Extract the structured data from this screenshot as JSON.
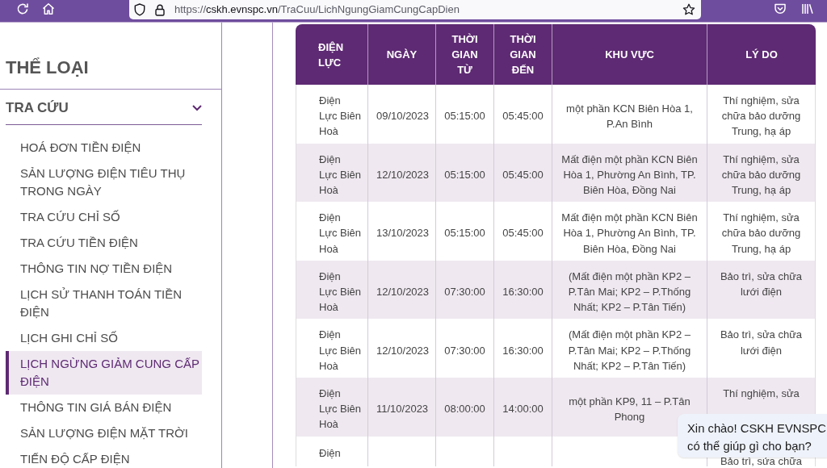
{
  "browser": {
    "url": {
      "scheme": "https://",
      "host": "cskh.evnspc.vn",
      "path": "/TraCuu/LichNgungGiamCungCapDien"
    }
  },
  "sidebar": {
    "title": "THỂ LOẠI",
    "section": {
      "label": "TRA CỨU",
      "expanded": true
    },
    "items": [
      {
        "label": "HOÁ ĐƠN TIỀN ĐIỆN",
        "selected": false
      },
      {
        "label": "SẢN LƯỢNG ĐIỆN TIÊU THỤ TRONG NGÀY",
        "selected": false
      },
      {
        "label": "TRA CỨU CHỈ SỐ",
        "selected": false
      },
      {
        "label": "TRA CỨU TIỀN ĐIỆN",
        "selected": false
      },
      {
        "label": "THÔNG TIN NỢ TIỀN ĐIỆN",
        "selected": false
      },
      {
        "label": "LỊCH SỬ THANH TOÁN TIỀN ĐIỆN",
        "selected": false
      },
      {
        "label": "LỊCH GHI CHỈ SỐ",
        "selected": false
      },
      {
        "label": "LỊCH NGỪNG GIẢM CUNG CẤP ĐIỆN",
        "selected": true
      },
      {
        "label": "THÔNG TIN GIÁ BÁN ĐIỆN",
        "selected": false
      },
      {
        "label": "SẢN LƯỢNG ĐIỆN MẶT TRỜI",
        "selected": false
      },
      {
        "label": "TIẾN ĐỘ CẤP ĐIỆN",
        "selected": false
      }
    ]
  },
  "table": {
    "columns": [
      "ĐIỆN LỰC",
      "NGÀY",
      "THỜI GIAN TỪ",
      "THỜI GIAN ĐẾN",
      "KHU VỰC",
      "LÝ DO"
    ],
    "rows": [
      {
        "unit": "Điện Lực Biên Hoà",
        "date": "09/10/2023",
        "from": "05:15:00",
        "to": "05:45:00",
        "area": "một phần KCN Biên Hòa 1, P.An Bình",
        "reason": "Thí nghiệm, sửa chữa bảo dưỡng Trung, hạ áp"
      },
      {
        "unit": "Điện Lực Biên Hoà",
        "date": "12/10/2023",
        "from": "05:15:00",
        "to": "05:45:00",
        "area": "Mất điện một phần KCN Biên Hòa 1, Phường An Bình, TP. Biên Hòa, Đồng Nai",
        "reason": "Thí nghiệm, sửa chữa bảo dưỡng Trung, hạ áp"
      },
      {
        "unit": "Điện Lực Biên Hoà",
        "date": "13/10/2023",
        "from": "05:15:00",
        "to": "05:45:00",
        "area": "Mất điện một phần KCN Biên Hòa 1, Phường An Bình, TP. Biên Hòa, Đồng Nai",
        "reason": "Thí nghiệm, sửa chữa bảo dưỡng Trung, hạ áp"
      },
      {
        "unit": "Điện Lực Biên Hoà",
        "date": "12/10/2023",
        "from": "07:30:00",
        "to": "16:30:00",
        "area": "(Mất điện một phần KP2 – P.Tân Mai; KP2 – P.Thống Nhất; KP2 – P.Tân Tiến)",
        "reason": "Bảo trì, sửa chữa lưới điện"
      },
      {
        "unit": "Điện Lực Biên Hoà",
        "date": "12/10/2023",
        "from": "07:30:00",
        "to": "16:30:00",
        "area": "(Mất điện một phần KP2 – P.Tân Mai; KP2 – P.Thống Nhất; KP2 – P.Tân Tiến)",
        "reason": "Bảo trì, sửa chữa lưới điện"
      },
      {
        "unit": "Điện Lực Biên Hoà",
        "date": "11/10/2023",
        "from": "08:00:00",
        "to": "14:00:00",
        "area": "một phần KP9, 11 – P.Tân Phong",
        "reason": "Thí nghiệm, sửa"
      },
      {
        "unit": "Điện",
        "reason": "Bảo trì, sửa chữa"
      }
    ]
  },
  "chat_bubble": {
    "text": "Xin chào! CSKH EVNSPC có thể giúp gì cho bạn?"
  }
}
